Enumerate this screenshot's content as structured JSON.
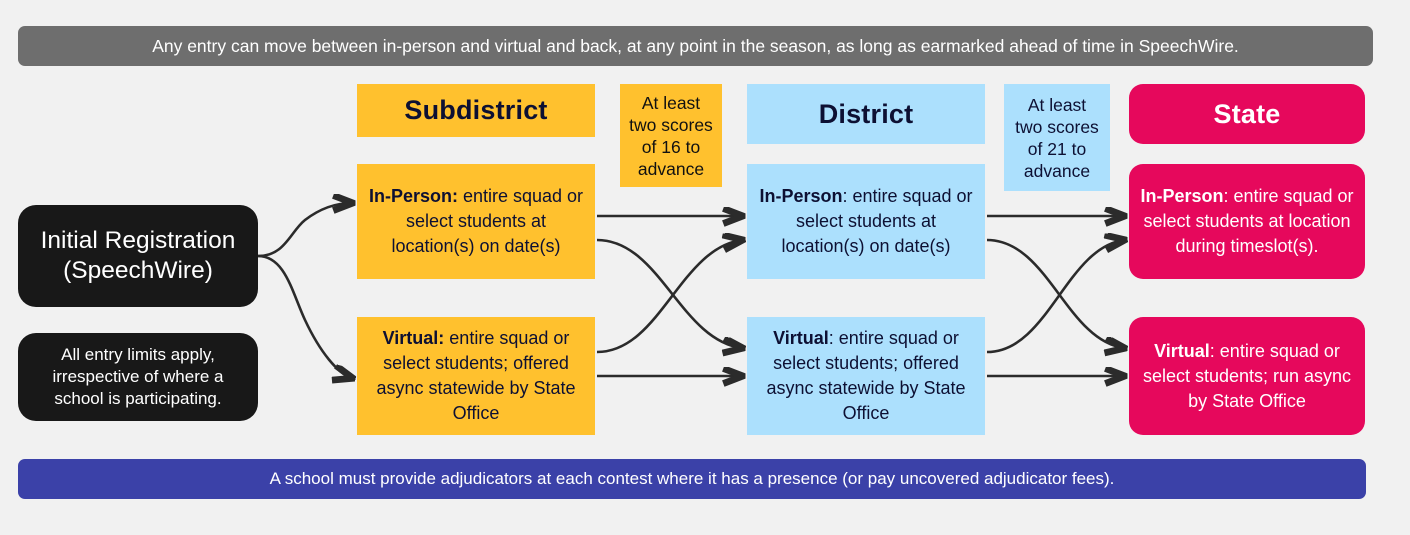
{
  "top_banner": {
    "text": "Any entry can move between in-person and virtual and back, at any point in the season, as long as earmarked ahead of time in SpeechWire.",
    "color": "#6e6e6e"
  },
  "bottom_banner": {
    "text": "A school must provide adjudicators at each contest where it has a presence (or pay uncovered adjudicator fees).",
    "color": "#3b41a8"
  },
  "start": {
    "registration": "Initial Registration (SpeechWire)",
    "entry_limits": "All entry limits apply, irrespective of where a school is participating.",
    "color": "#181818"
  },
  "columns": {
    "subdistrict": {
      "header": "Subdistrict",
      "color": "#ffc12e",
      "in_person_label": "In-Person:",
      "in_person_text": " entire squad or select students at location(s) on date(s)",
      "virtual_label": "Virtual:",
      "virtual_text": " entire squad or select students; offered async statewide by State Office"
    },
    "district": {
      "header": "District",
      "color": "#ace0fd",
      "in_person_label": "In-Person",
      "in_person_text": ": entire squad or select students at location(s) on date(s)",
      "virtual_label": "Virtual",
      "virtual_text": ": entire squad or select students; offered async statewide by State Office"
    },
    "state": {
      "header": "State",
      "color": "#e6085c",
      "in_person_label": "In-Person",
      "in_person_text": ": entire squad or select students at location during timeslot(s).",
      "virtual_label": "Virtual",
      "virtual_text": ": entire squad or select students; run async by State Office"
    }
  },
  "advance_gates": [
    {
      "text": "At least two scores of 16 to advance",
      "threshold": "16",
      "color": "#ffc12e"
    },
    {
      "text": "At least two scores of 21 to advance",
      "threshold": "21",
      "color": "#ace0fd"
    }
  ]
}
